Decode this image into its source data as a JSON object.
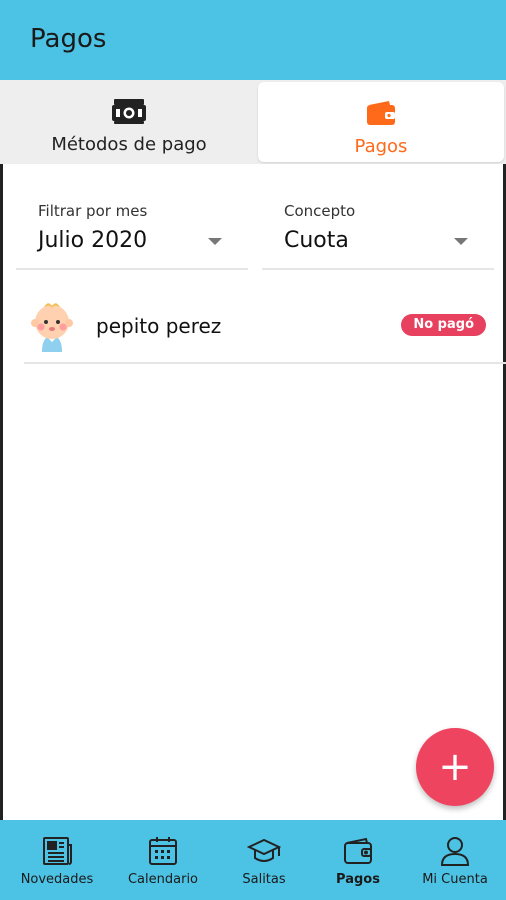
{
  "appbar": {
    "title": "Pagos"
  },
  "tabs": [
    {
      "label": "Métodos de pago",
      "icon": "cash-icon",
      "active": false
    },
    {
      "label": "Pagos",
      "icon": "wallet-icon",
      "active": true
    }
  ],
  "filters": {
    "mes": {
      "label": "Filtrar por mes",
      "value": "Julio 2020"
    },
    "concepto": {
      "label": "Concepto",
      "value": "Cuota"
    }
  },
  "payments": [
    {
      "name": "pepito perez",
      "status": "No pagó",
      "avatar": "baby-avatar-icon"
    }
  ],
  "fab": {
    "symbol": "+"
  },
  "bottom_nav": [
    {
      "label": "Novedades",
      "icon": "newspaper-icon"
    },
    {
      "label": "Calendario",
      "icon": "calendar-icon"
    },
    {
      "label": "Salitas",
      "icon": "graduation-cap-icon"
    },
    {
      "label": "Pagos",
      "icon": "wallet-icon",
      "active": true
    },
    {
      "label": "Mi Cuenta",
      "icon": "user-icon"
    }
  ],
  "colors": {
    "primary": "#4cc3e4",
    "active_tab": "#ff6a1a",
    "badge": "#e8405f",
    "fab": "#ef4460"
  }
}
